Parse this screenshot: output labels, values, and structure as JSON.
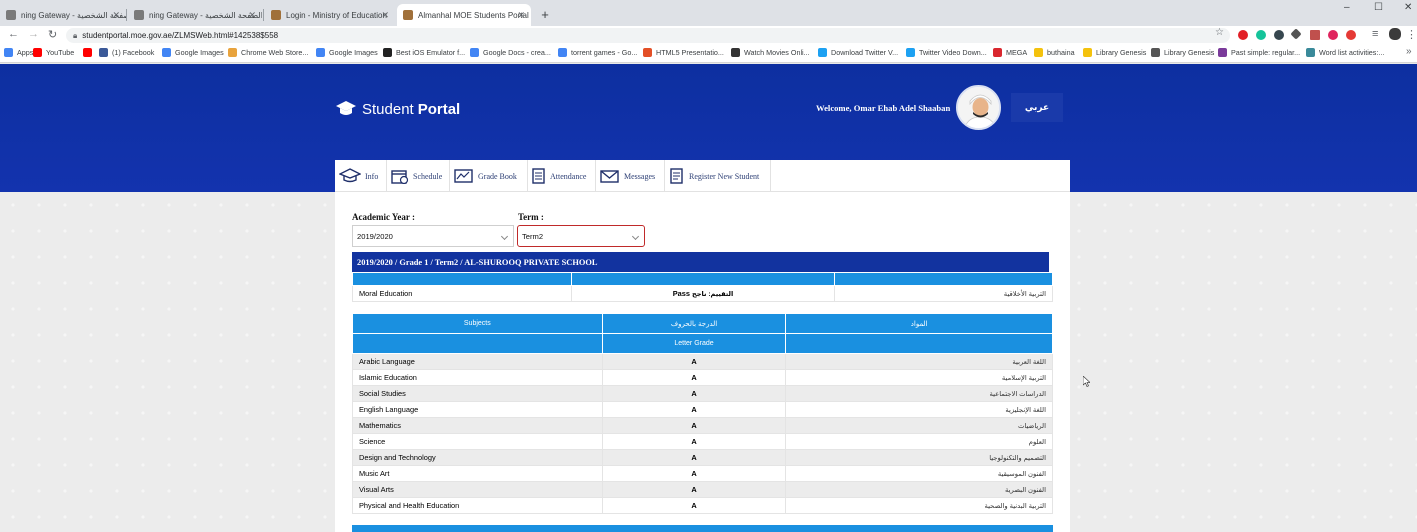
{
  "browser": {
    "tabs": [
      {
        "title": "ning Gateway - الصفحة الشخصية",
        "fav": "#7a7a7a"
      },
      {
        "title": "ning Gateway - الصفحة الشخصية",
        "fav": "#7a7a7a"
      },
      {
        "title": "Login - Ministry of Education",
        "fav": "#a0703a"
      },
      {
        "title": "Almanhal MOE Students Portal",
        "fav": "#a0703a"
      }
    ],
    "window_controls": [
      "–",
      "☐",
      "✕"
    ],
    "url": "studentportal.moe.gov.ae/ZLMSWeb.html#142538$558",
    "bookmarks": [
      {
        "label": "Apps",
        "color": "#4285f4"
      },
      {
        "label": "YouTube",
        "color": "#ff0000"
      },
      {
        "label": "",
        "color": "#ff0000"
      },
      {
        "label": "(1) Facebook",
        "color": "#3b5998"
      },
      {
        "label": "Google Images",
        "color": "#4285f4"
      },
      {
        "label": "Chrome Web Store...",
        "color": "#e8a33d"
      },
      {
        "label": "Google Images",
        "color": "#4285f4"
      },
      {
        "label": "Best iOS Emulator f...",
        "color": "#222222"
      },
      {
        "label": "Google Docs - crea...",
        "color": "#4285f4"
      },
      {
        "label": "torrent games - Go...",
        "color": "#4285f4"
      },
      {
        "label": "HTML5 Presentatio...",
        "color": "#e34f26"
      },
      {
        "label": "Watch Movies Onli...",
        "color": "#333333"
      },
      {
        "label": "Download Twitter V...",
        "color": "#1da1f2"
      },
      {
        "label": "Twitter Video Down...",
        "color": "#1da1f2"
      },
      {
        "label": "MEGA",
        "color": "#d9272e"
      },
      {
        "label": "buthaina",
        "color": "#f4c20d"
      },
      {
        "label": "Library Genesis",
        "color": "#f4c20d"
      },
      {
        "label": "Library Genesis",
        "color": "#555555"
      },
      {
        "label": "Past simple: regular...",
        "color": "#7a3a9a"
      },
      {
        "label": "Word list activities:...",
        "color": "#3a8a9a"
      }
    ]
  },
  "header": {
    "logo_light": "Student",
    "logo_bold": "Portal",
    "welcome": "Welcome, Omar Ehab Adel Shaaban",
    "language_button": "عربي"
  },
  "nav_tabs": [
    {
      "label": "Info",
      "icon": "graduation-cap-icon"
    },
    {
      "label": "Schedule",
      "icon": "calendar-icon"
    },
    {
      "label": "Grade Book",
      "icon": "gradebook-icon"
    },
    {
      "label": "Attendance",
      "icon": "attendance-icon"
    },
    {
      "label": "Messages",
      "icon": "envelope-icon"
    },
    {
      "label": "Register New Student",
      "icon": "register-icon"
    }
  ],
  "filters": {
    "academic_year_label": "Academic Year :",
    "academic_year_value": "2019/2020",
    "term_label": "Term :",
    "term_value": "Term2"
  },
  "school_bar": "2019/2020 / Grade 1 / Term2 / AL-SHUROOQ PRIVATE SCHOOL",
  "moral": {
    "subject_en": "Moral Education",
    "result_ar": "التقييم: ناجح",
    "result_en": "Pass",
    "subject_ar": "التربية الأخلاقية"
  },
  "grades_table": {
    "col_subjects": "Subjects",
    "col_letter_ar": "الدرجة بالحروف",
    "col_subjects_ar": "المواد",
    "sub_letter_grade": "Letter Grade",
    "rows": [
      {
        "en": "Arabic Language",
        "grade": "A",
        "ar": "اللغة العربية"
      },
      {
        "en": "Islamic Education",
        "grade": "A",
        "ar": "التربية الإسلامية"
      },
      {
        "en": "Social Studies",
        "grade": "A",
        "ar": "الدراسات الاجتماعية"
      },
      {
        "en": "English Language",
        "grade": "A",
        "ar": "اللغة الإنجليزية"
      },
      {
        "en": "Mathematics",
        "grade": "A",
        "ar": "الرياضيات"
      },
      {
        "en": "Science",
        "grade": "A",
        "ar": "العلوم"
      },
      {
        "en": "Design and Technology",
        "grade": "A",
        "ar": "التصميم والتكنولوجيا"
      },
      {
        "en": "Music Art",
        "grade": "A",
        "ar": "الفنون الموسيقية"
      },
      {
        "en": "Visual Arts",
        "grade": "A",
        "ar": "الفنون البصرية"
      },
      {
        "en": "Physical and Health Education",
        "grade": "A",
        "ar": "التربية البدنية والصحية"
      }
    ]
  },
  "colors": {
    "banner": "#0d2fa0",
    "table_header": "#1a90e0",
    "school_bar": "#12339f"
  }
}
